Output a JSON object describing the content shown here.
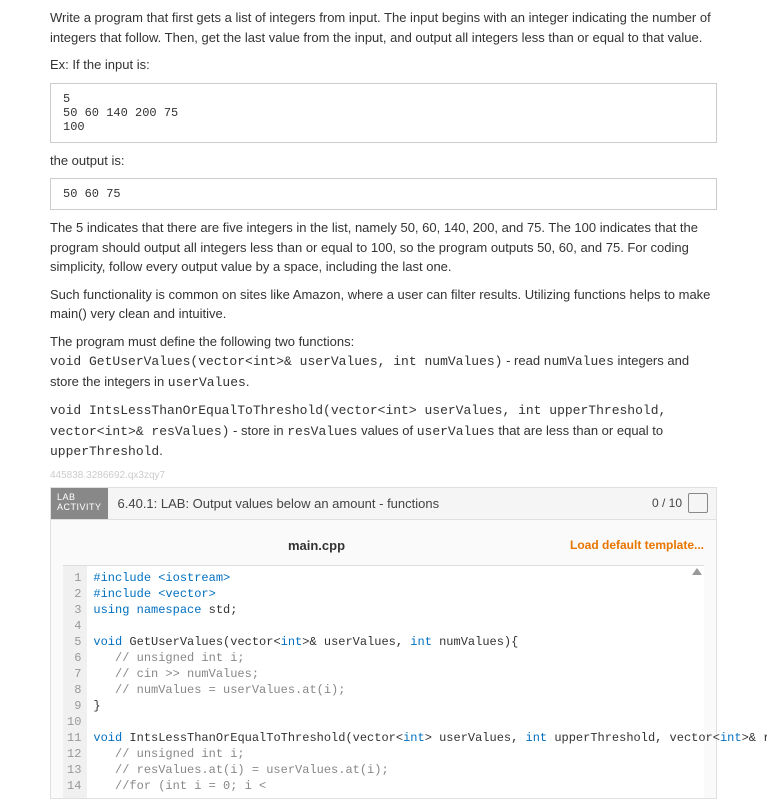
{
  "intro": {
    "p1": "Write a program that first gets a list of integers from input. The input begins with an integer indicating the number of integers that follow. Then, get the last value from the input, and output all integers less than or equal to that value.",
    "ex_label": "Ex: If the input is:",
    "input_example": "5\n50 60 140 200 75\n100",
    "output_label": "the output is:",
    "output_example": "50 60 75 ",
    "p2": "The 5 indicates that there are five integers in the list, namely 50, 60, 140, 200, and 75. The 100 indicates that the program should output all integers less than or equal to 100, so the program outputs 50, 60, and 75. For coding simplicity, follow every output value by a space, including the last one.",
    "p3": "Such functionality is common on sites like Amazon, where a user can filter results. Utilizing functions helps to make main() very clean and intuitive.",
    "p4a": "The program must define the following two functions:",
    "sig1": "void GetUserValues(vector<int>& userValues, int numValues)",
    "sig1_tail_a": " - read ",
    "sig1_tail_b": "numValues",
    "sig1_tail_c": " integers and store the integers in ",
    "sig1_tail_d": "userValues",
    "sig1_tail_e": ".",
    "sig2": "void IntsLessThanOrEqualToThreshold(vector<int> userValues, int upperThreshold, vector<int>& resValues)",
    "sig2_tail_a": " - store in ",
    "sig2_tail_b": "resValues",
    "sig2_tail_c": " values of ",
    "sig2_tail_d": "userValues",
    "sig2_tail_e": " that are less than or equal to ",
    "sig2_tail_f": "upperThreshold",
    "sig2_tail_g": ".",
    "faded_id": "445838.3286692.qx3zqy7"
  },
  "lab": {
    "tag1": "LAB",
    "tag2": "ACTIVITY",
    "title": "6.40.1: LAB: Output values below an amount - functions",
    "score": "0 / 10",
    "filename": "main.cpp",
    "load_template": "Load default template..."
  },
  "code": {
    "lines": [
      {
        "n": "1",
        "t": "#include <iostream>",
        "cls": "kw-line"
      },
      {
        "n": "2",
        "t": "#include <vector>",
        "cls": "kw-line"
      },
      {
        "n": "3",
        "t": "using namespace std;",
        "cls": "mix1"
      },
      {
        "n": "4",
        "t": "",
        "cls": ""
      },
      {
        "n": "5",
        "t": "void GetUserValues(vector<int>& userValues, int numValues){",
        "cls": "mix2"
      },
      {
        "n": "6",
        "t": "   // unsigned int i;",
        "cls": "com"
      },
      {
        "n": "7",
        "t": "   // cin >> numValues;",
        "cls": "com"
      },
      {
        "n": "8",
        "t": "   // numValues = userValues.at(i);",
        "cls": "com"
      },
      {
        "n": "9",
        "t": "}",
        "cls": ""
      },
      {
        "n": "10",
        "t": "",
        "cls": ""
      },
      {
        "n": "11",
        "t": "void IntsLessThanOrEqualToThreshold(vector<int> userValues, int upperThreshold, vector<int>& resValues){",
        "cls": "mix3"
      },
      {
        "n": "12",
        "t": "   // unsigned int i;",
        "cls": "com"
      },
      {
        "n": "13",
        "t": "   // resValues.at(i) = userValues.at(i);",
        "cls": "com"
      },
      {
        "n": "14",
        "t": "   //for (int i = 0; i <",
        "cls": "com"
      }
    ]
  }
}
